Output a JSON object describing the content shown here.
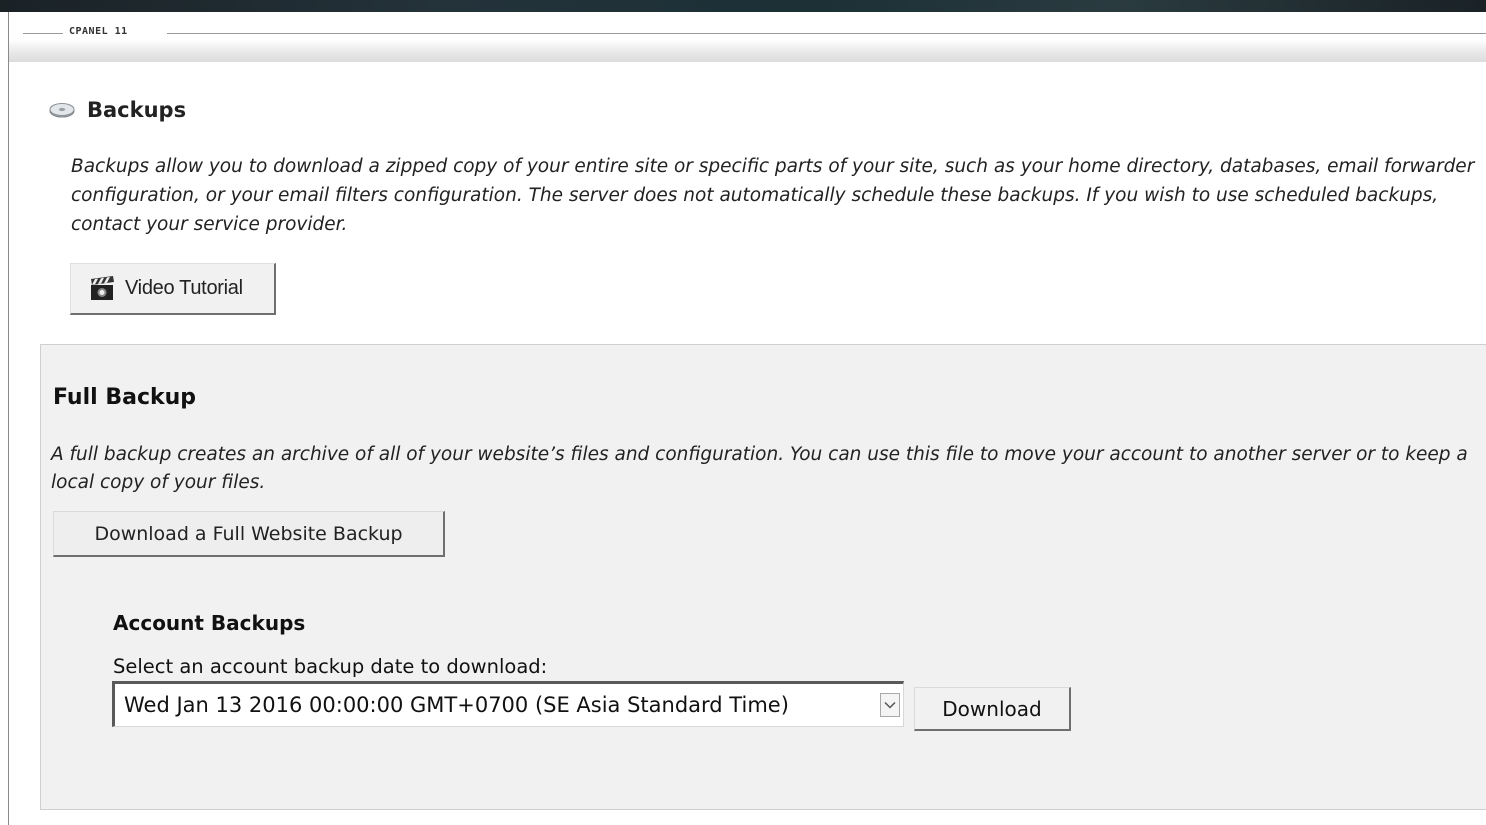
{
  "branding": {
    "section_label": "CPANEL 11"
  },
  "page": {
    "title": "Backups",
    "title_icon": "disk-icon",
    "description": "Backups allow you to download a zipped copy of your entire site or specific parts of your site, such as your home directory, databases, email forwarder configuration, or your email filters configuration. The server does not automatically schedule these backups. If you wish to use scheduled backups, contact your service provider.",
    "video_tutorial": {
      "label": "Video Tutorial",
      "icon": "video-camera-icon"
    }
  },
  "full_backup": {
    "heading": "Full Backup",
    "description": "A full backup creates an archive of all of your website’s files and configuration. You can use this file to move your account to another server or to keep a local copy of your files.",
    "button_label": "Download a Full Website Backup"
  },
  "account_backups": {
    "heading": "Account Backups",
    "select_label": "Select an account backup date to download:",
    "selected_value": "Wed Jan 13 2016 00:00:00 GMT+0700 (SE Asia Standard Time)",
    "download_label": "Download"
  },
  "colors": {
    "panel_background": "#f1f1f1",
    "button_shadow": "#6f6f6f",
    "top_strip": "#1a2226"
  }
}
